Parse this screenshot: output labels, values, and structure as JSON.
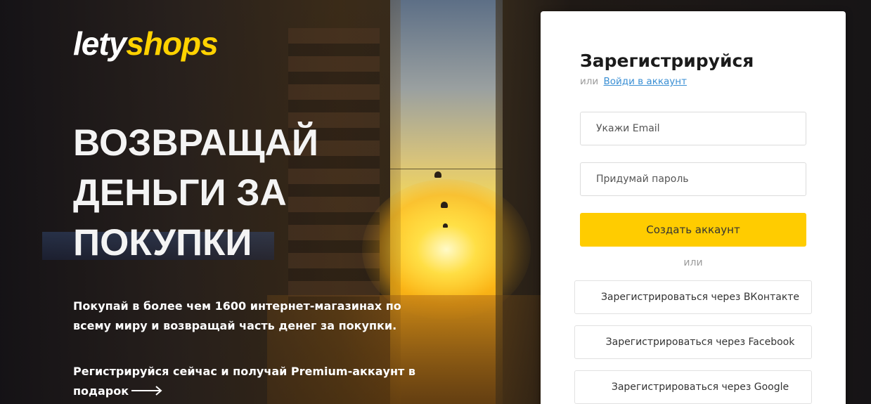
{
  "brand": {
    "logo_part1": "lety",
    "logo_part2": "shops",
    "accent_color": "#ffcc00"
  },
  "hero": {
    "headline_lines": [
      "ВОЗВРАЩАЙ",
      "ДЕНЬГИ ЗА",
      "ПОКУПКИ"
    ],
    "lead": "Покупай в более чем 1600 интернет-магазинах по всему миру и возвращай часть денег за покупки.",
    "promo": "Регистрируйся сейчас и получай Premium-аккаунт в подарок",
    "promo_icon": "arrow-right-icon"
  },
  "signup": {
    "title": "Зарегистрируйся",
    "alt_prefix": "или",
    "login_link": "Войди в аккаунт",
    "email_placeholder": "Укажи Email",
    "password_placeholder": "Придумай пароль",
    "submit_label": "Создать аккаунт",
    "or_label": "или",
    "social": [
      {
        "label": "Зарегистрироваться через ВКонтакте",
        "icon": "vk-icon"
      },
      {
        "label": "Зарегистрироваться через Facebook",
        "icon": "facebook-icon"
      },
      {
        "label": "Зарегистрироваться через Google",
        "icon": "google-icon"
      }
    ]
  }
}
